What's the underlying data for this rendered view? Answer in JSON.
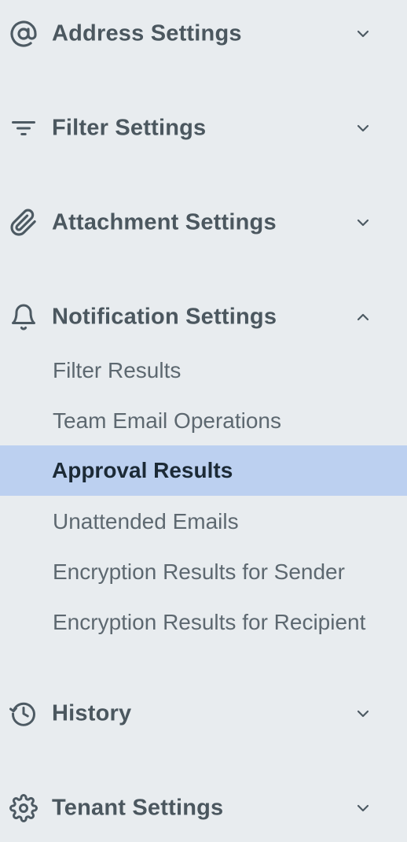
{
  "sidebar": {
    "sections": [
      {
        "label": "Address Settings",
        "icon": "at-sign-icon",
        "expanded": false
      },
      {
        "label": "Filter Settings",
        "icon": "filter-icon",
        "expanded": false
      },
      {
        "label": "Attachment Settings",
        "icon": "paperclip-icon",
        "expanded": false
      },
      {
        "label": "Notification Settings",
        "icon": "bell-icon",
        "expanded": true,
        "items": [
          {
            "label": "Filter Results",
            "active": false
          },
          {
            "label": "Team Email Operations",
            "active": false
          },
          {
            "label": "Approval Results",
            "active": true
          },
          {
            "label": "Unattended Emails",
            "active": false
          },
          {
            "label": "Encryption Results for Sender",
            "active": false
          },
          {
            "label": "Encryption Results for Recipient",
            "active": false
          }
        ]
      },
      {
        "label": "History",
        "icon": "history-icon",
        "expanded": false
      },
      {
        "label": "Tenant Settings",
        "icon": "gear-icon",
        "expanded": false
      }
    ]
  },
  "colors": {
    "background": "#e8ecef",
    "active_background": "#bcd0f0",
    "header_text": "#4b575f",
    "item_text": "#5d6870",
    "active_text": "#1c2a36"
  }
}
